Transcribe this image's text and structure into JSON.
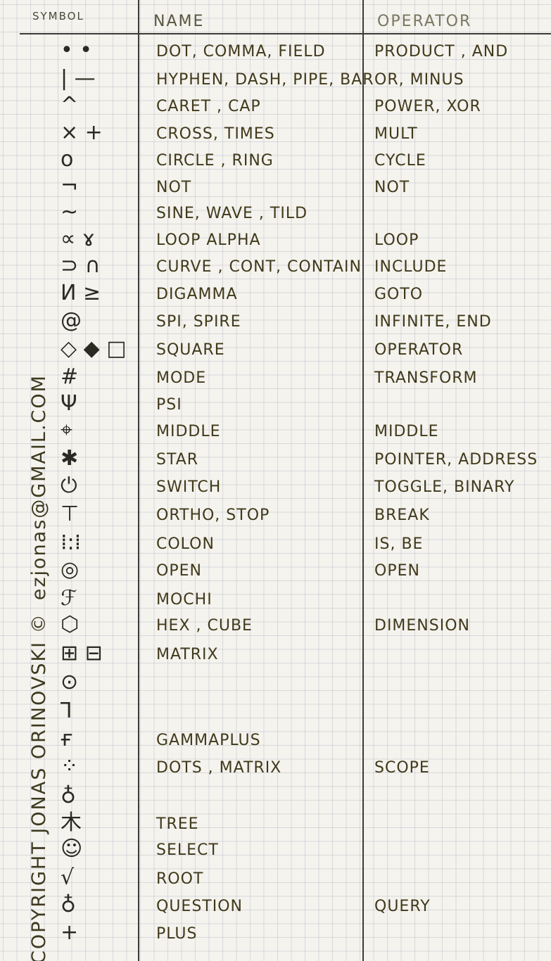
{
  "headers": {
    "symbol": "SYMBOL",
    "name": "NAME",
    "operator": "OPERATOR"
  },
  "side_text": {
    "copyright": "COPYRIGHT JONAS ORINOVSKI ©",
    "email": "ezjonas@GMAIL.COM"
  },
  "rows": [
    {
      "symbol": "• •",
      "name": "DOT, COMMA, FIELD",
      "operator": "PRODUCT , AND"
    },
    {
      "symbol": "| —",
      "name": "HYPHEN, DASH, PIPE, BAR",
      "operator": "OR, MINUS"
    },
    {
      "symbol": "^",
      "name": "CARET , CAP",
      "operator": "POWER, XOR"
    },
    {
      "symbol": "× +",
      "name": "CROSS, TIMES",
      "operator": "MULT"
    },
    {
      "symbol": "o",
      "name": "CIRCLE , RING",
      "operator": "CYCLE"
    },
    {
      "symbol": "¬",
      "name": "NOT",
      "operator": "NOT"
    },
    {
      "symbol": "~",
      "name": "SINE, WAVE , TILD",
      "operator": ""
    },
    {
      "symbol": "∝ ɤ",
      "name": "LOOP ALPHA",
      "operator": "LOOP"
    },
    {
      "symbol": "⊃ ∩",
      "name": "CURVE , CONT, CONTAIN",
      "operator": "INCLUDE"
    },
    {
      "symbol": "И ≥",
      "name": "DIGAMMA",
      "operator": "GOTO"
    },
    {
      "symbol": "@",
      "name": "SPI, SPIRE",
      "operator": "INFINITE, END"
    },
    {
      "symbol": "◇ ◆ □",
      "name": "SQUARE",
      "operator": "OPERATOR"
    },
    {
      "symbol": "#",
      "name": "MODE",
      "operator": "TRANSFORM"
    },
    {
      "symbol": "Ψ",
      "name": "PSI",
      "operator": ""
    },
    {
      "symbol": "⌖",
      "name": "MIDDLE",
      "operator": "MIDDLE"
    },
    {
      "symbol": "✱",
      "name": "STAR",
      "operator": "POINTER, ADDRESS"
    },
    {
      "symbol": "⏻",
      "name": "SWITCH",
      "operator": "TOGGLE, BINARY"
    },
    {
      "symbol": "⊤",
      "name": "ORTHO, STOP",
      "operator": "BREAK"
    },
    {
      "symbol": "⁞:⁞",
      "name": "COLON",
      "operator": "IS, BE"
    },
    {
      "symbol": "◎",
      "name": "OPEN",
      "operator": "OPEN"
    },
    {
      "symbol": "ℱ",
      "name": "MOCHI",
      "operator": ""
    },
    {
      "symbol": "⬡",
      "name": "HEX , CUBE",
      "operator": "DIMENSION"
    },
    {
      "symbol": "⊞ ⊟",
      "name": "MATRIX",
      "operator": ""
    },
    {
      "symbol": "⊙",
      "name": "",
      "operator": ""
    },
    {
      "symbol": "⅂",
      "name": "",
      "operator": ""
    },
    {
      "symbol": "ғ",
      "name": "GAMMAPLUS",
      "operator": ""
    },
    {
      "symbol": "⁘",
      "name": "DOTS , MATRIX",
      "operator": "SCOPE"
    },
    {
      "symbol": "♁",
      "name": "",
      "operator": ""
    },
    {
      "symbol": "木",
      "name": "TREE",
      "operator": ""
    },
    {
      "symbol": "☺",
      "name": "SELECT",
      "operator": ""
    },
    {
      "symbol": "√",
      "name": "ROOT",
      "operator": ""
    },
    {
      "symbol": "♁",
      "name": "QUESTION",
      "operator": "QUERY"
    },
    {
      "symbol": "+",
      "name": "PLUS",
      "operator": ""
    }
  ]
}
